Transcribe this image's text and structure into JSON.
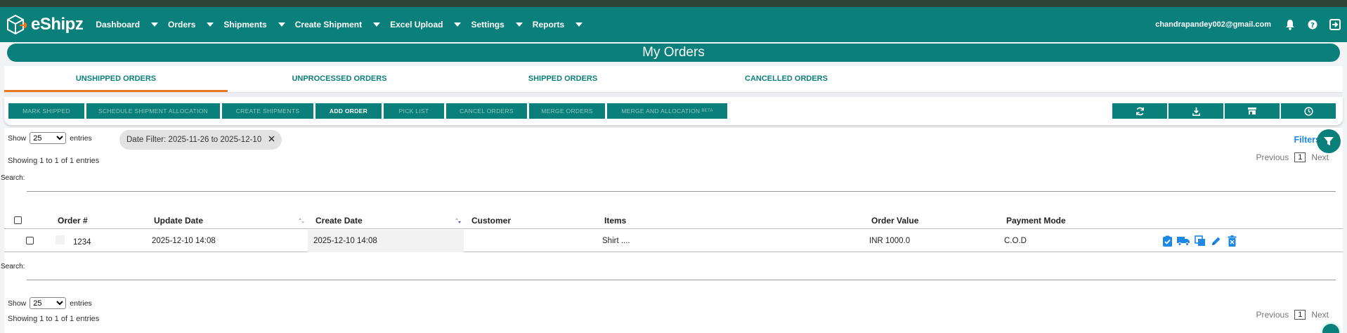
{
  "brand": {
    "name": "eShipz"
  },
  "nav": {
    "items": [
      "Dashboard",
      "Orders",
      "Shipments",
      "Create Shipment",
      "Excel Upload",
      "Settings",
      "Reports"
    ],
    "user_email": "chandrapandey002@gmail.com"
  },
  "page": {
    "title": "My Orders"
  },
  "tabs": [
    "UNSHIPPED ORDERS",
    "UNPROCESSED ORDERS",
    "SHIPPED ORDERS",
    "CANCELLED ORDERS"
  ],
  "toolbar": {
    "mark_shipped": "MARK SHIPPED",
    "schedule": "SCHEDULE SHIPMENT ALLOCATION",
    "create": "CREATE SHIPMENTS",
    "add": "ADD ORDER",
    "pick": "PICK LIST",
    "cancel": "CANCEL ORDERS",
    "merge": "MERGE ORDERS",
    "merge_alloc": "MERGE AND ALLOCATION",
    "beta": "BETA"
  },
  "table_controls": {
    "show_label": "Show",
    "entries_label": "entries",
    "page_length": "25",
    "date_filter": "Date Filter: 2025-11-26 to 2025-12-10",
    "filters_label": "Filters",
    "info_text": "Showing 1 to 1 of 1 entries",
    "previous": "Previous",
    "next": "Next",
    "page_num": "1",
    "search_label": "Search:"
  },
  "columns": [
    "Order #",
    "Update Date",
    "Create Date",
    "Customer",
    "Items",
    "Order Value",
    "Payment Mode"
  ],
  "rows": [
    {
      "order": "1234",
      "update_date": "2025-12-10 14:08",
      "create_date": "2025-12-10 14:08",
      "customer": "",
      "items": "Shirt ....",
      "order_value": "INR 1000.0",
      "payment_mode": "C.O.D"
    }
  ],
  "colors": {
    "primary": "#0b7f7a",
    "accent": "#e87722",
    "link": "#1e88e5",
    "action": "#1e88e5"
  },
  "icons": {
    "nav_right": [
      "bell-icon",
      "help-icon",
      "logout-icon"
    ],
    "toolbar_right": [
      "refresh-icon",
      "download-icon",
      "store-icon",
      "clock-icon"
    ],
    "row_actions": [
      "clipboard-check-icon",
      "truck-icon",
      "copy-icon",
      "edit-icon",
      "delete-icon"
    ]
  }
}
